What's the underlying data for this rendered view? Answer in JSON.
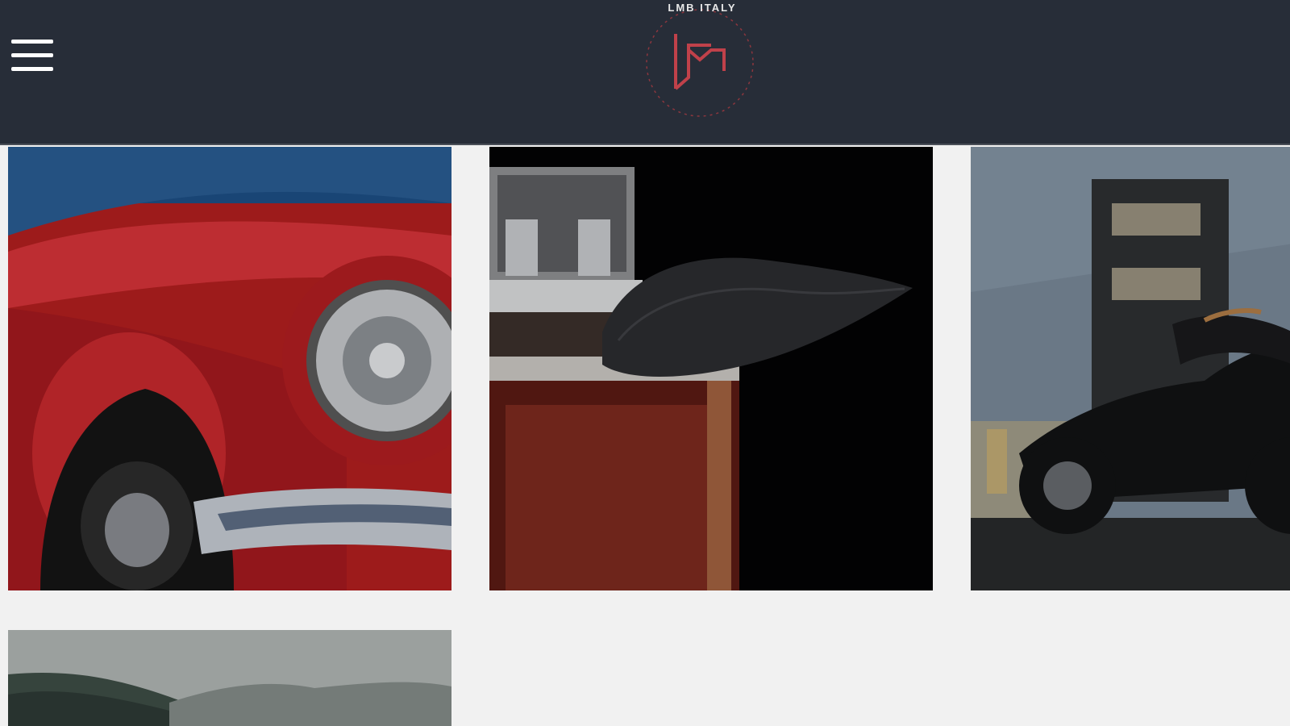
{
  "header": {
    "brand_text": "LMB ITALY",
    "menu_icon": "hamburger-menu-icon",
    "background": "#272d38",
    "logo_color": "#b83a42"
  },
  "gallery": {
    "items": [
      {
        "id": "car",
        "subject": "red-classic-car-headlight"
      },
      {
        "id": "perfume",
        "subject": "perfume-bottle"
      },
      {
        "id": "moto",
        "subject": "black-motorcycle"
      },
      {
        "id": "landscape",
        "subject": "mountain-landscape"
      }
    ]
  }
}
